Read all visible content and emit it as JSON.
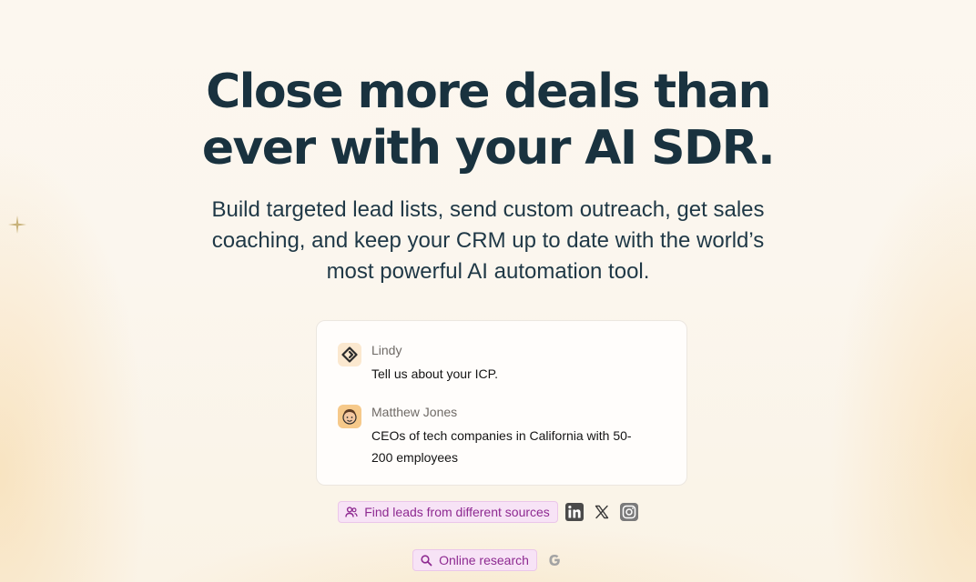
{
  "hero": {
    "headline_line1": "Close more deals than",
    "headline_line2": "ever with your AI SDR.",
    "subhead": "Build targeted lead lists, send custom outreach, get sales coaching, and keep your CRM up to date with the world’s most powerful AI automation tool."
  },
  "chat": {
    "messages": [
      {
        "name": "Lindy",
        "text": "Tell us about your ICP.",
        "avatar": "lindy-logo-icon"
      },
      {
        "name": "Matthew Jones",
        "text": "CEOs of tech companies in California with 50-200 employees",
        "avatar": "user-avatar"
      }
    ]
  },
  "actions": {
    "find_leads": {
      "label": "Find leads from different sources",
      "icon": "users-icon"
    },
    "sources": [
      "linkedin-icon",
      "x-icon",
      "instagram-icon"
    ],
    "online_research": {
      "label": "Online research",
      "icon": "search-icon"
    },
    "research_sources": [
      "google-icon"
    ]
  },
  "colors": {
    "heading": "#19323f",
    "pill_bg": "#f7e3f6",
    "pill_text": "#8e2a91",
    "card_border": "#ece7e0"
  }
}
